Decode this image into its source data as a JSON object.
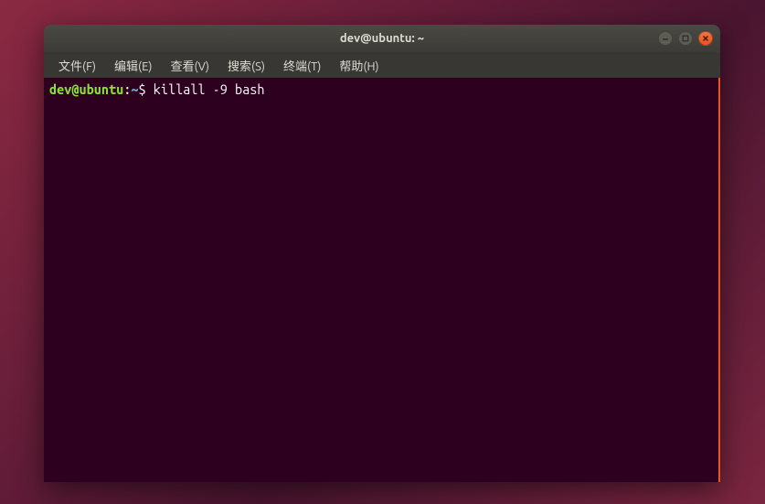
{
  "window": {
    "title": "dev@ubuntu: ~"
  },
  "menubar": {
    "items": [
      "文件(F)",
      "编辑(E)",
      "查看(V)",
      "搜索(S)",
      "终端(T)",
      "帮助(H)"
    ]
  },
  "terminal": {
    "prompt": {
      "user_host": "dev@ubuntu",
      "colon": ":",
      "path": "~",
      "dollar": "$ "
    },
    "command": "killall -9 bash"
  },
  "colors": {
    "terminal_bg": "#2C001E",
    "accent": "#E95420",
    "prompt_green": "#8AE234",
    "prompt_blue": "#729FCF"
  }
}
